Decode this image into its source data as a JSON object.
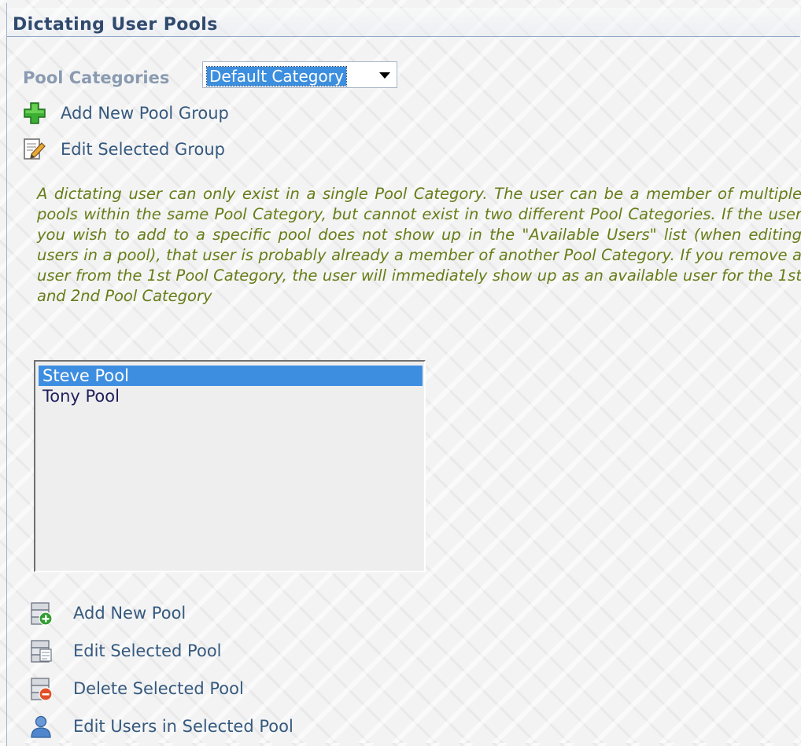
{
  "header": {
    "title": "Dictating User Pools"
  },
  "category": {
    "label": "Pool Categories",
    "selected_value": "Default Category"
  },
  "group_actions": {
    "add_group": "Add New Pool Group",
    "edit_group": "Edit Selected Group"
  },
  "info_text": "A dictating user can only exist in a single Pool Category. The user can be a member of multiple pools within the same Pool Category, but cannot exist in two different Pool Categories. If the user you wish to add to a specific pool does not show up in the \"Available Users\" list (when editing users in a pool), that user is probably already a member of another Pool Category. If you remove a user from the 1st Pool Category, the user will immediately show up as an available user for the 1st and 2nd Pool Category",
  "pools": {
    "items": [
      {
        "label": "Steve Pool",
        "selected": true
      },
      {
        "label": "Tony Pool",
        "selected": false
      }
    ]
  },
  "pool_actions": {
    "add_pool": "Add New Pool",
    "edit_pool": "Edit Selected Pool",
    "delete_pool": "Delete Selected Pool",
    "edit_users": "Edit Users in Selected Pool"
  },
  "colors": {
    "title": "#304a6e",
    "link": "#35597f",
    "info_text": "#667d18",
    "selection": "#3d8ee0"
  },
  "icons": {
    "add_group": "green-plus-icon",
    "edit_group": "edit-document-icon",
    "add_pool": "add-pool-icon",
    "edit_pool": "edit-pool-icon",
    "delete_pool": "delete-pool-icon",
    "edit_users": "user-icon"
  }
}
